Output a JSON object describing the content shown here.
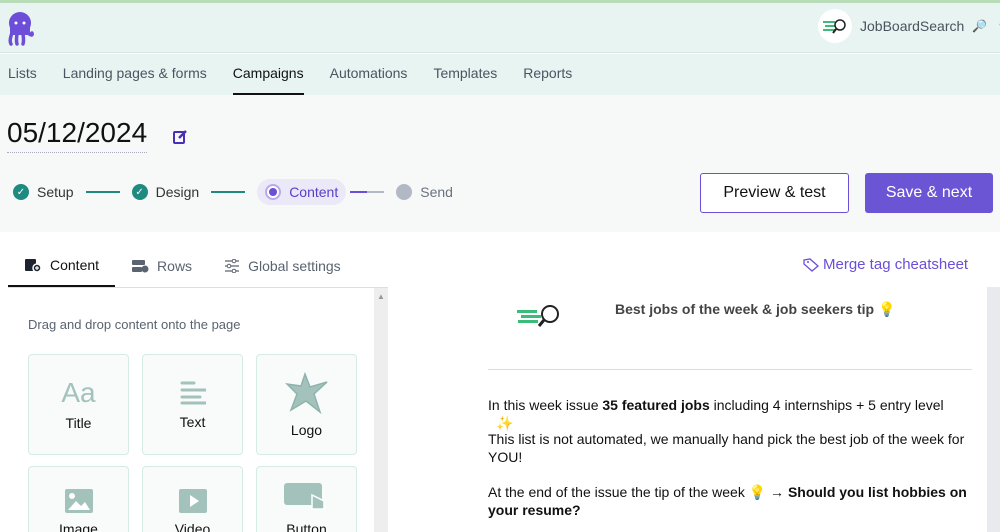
{
  "account": {
    "name": "JobBoardSearch",
    "emoji": "🔎"
  },
  "nav": [
    "Lists",
    "Landing pages & forms",
    "Campaigns",
    "Automations",
    "Templates",
    "Reports"
  ],
  "campaign": {
    "title": "05/12/2024"
  },
  "steps": [
    "Setup",
    "Design",
    "Content",
    "Send"
  ],
  "buttons": {
    "preview": "Preview & test",
    "save": "Save & next"
  },
  "tabs": [
    "Content",
    "Rows",
    "Global settings"
  ],
  "merge_link": "Merge tag cheatsheet",
  "panel": {
    "hint": "Drag and drop content onto the page",
    "blocks": [
      "Title",
      "Text",
      "Logo",
      "Image",
      "Video",
      "Button"
    ]
  },
  "email": {
    "title": "Best jobs of the week & job seekers tip 💡",
    "p1_a": "In this week issue ",
    "p1_b": "35 featured jobs",
    "p1_c": " including 4 internships + 5 entry level ",
    "p1_d": "✨",
    "p2": "This list is not automated, we manually hand pick the best job of the week for YOU!",
    "p3_a": "At the end of the issue the tip of the week 💡 → ",
    "p3_b": "Should you list hobbies on your resume?"
  }
}
